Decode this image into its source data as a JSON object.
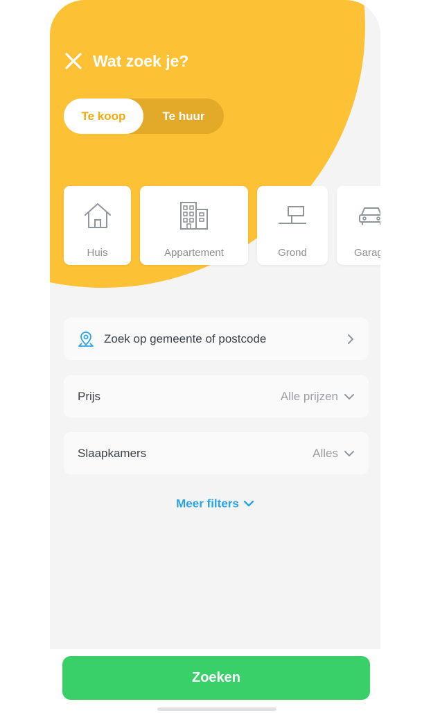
{
  "header": {
    "title": "Wat zoek je?",
    "close_icon": "close-icon"
  },
  "toggle": {
    "options": [
      "Te koop",
      "Te huur"
    ],
    "selected": "Te koop"
  },
  "property_types": [
    {
      "label": "Huis",
      "icon": "house-icon"
    },
    {
      "label": "Appartement",
      "icon": "apartment-building-icon"
    },
    {
      "label": "Grond",
      "icon": "land-sign-icon"
    },
    {
      "label": "Garage",
      "icon": "car-icon"
    }
  ],
  "location": {
    "placeholder": "Zoek op gemeente of postcode",
    "icon": "location-pin-icon"
  },
  "filters": {
    "price": {
      "label": "Prijs",
      "value": "Alle prijzen"
    },
    "bedrooms": {
      "label": "Slaapkamers",
      "value": "Alles"
    }
  },
  "more_filters": "Meer filters",
  "search_button": "Zoeken",
  "colors": {
    "accent_yellow": "#fcc134",
    "selected_text": "#f1a90c",
    "link_blue": "#2aa3e5",
    "search_green": "#39d06a",
    "background": "#f3f4f3"
  }
}
